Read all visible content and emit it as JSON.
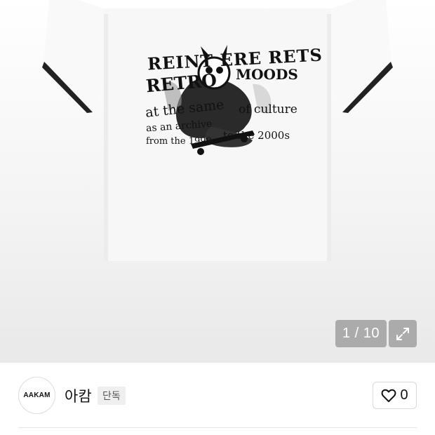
{
  "gallery": {
    "current": "1",
    "separator": " / ",
    "total": "10",
    "image_alt": "white ringer t-shirt with black retro graphic print",
    "shirt_print_lines": [
      "REINT ERE RETS",
      "RETRO",
      "MOODS",
      "at the same",
      "of culture",
      "as an archive",
      "from the 1990s",
      "to the 2000s"
    ],
    "expand_icon": "expand-icon"
  },
  "seller": {
    "logo_text": "AAKAM",
    "name": "아캄",
    "badge": "단독"
  },
  "like": {
    "icon": "heart-outline-icon",
    "count": "0"
  }
}
